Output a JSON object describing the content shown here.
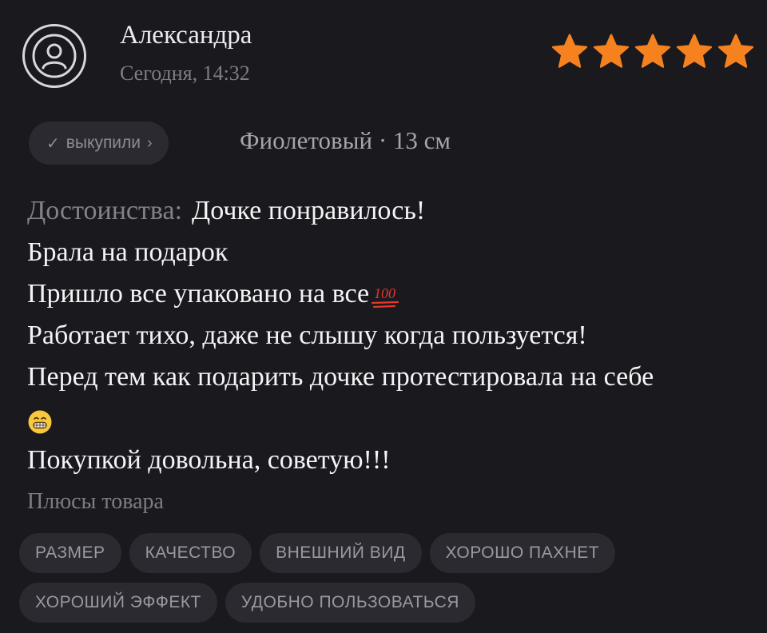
{
  "review": {
    "author": "Александра",
    "date": "Сегодня, 14:32",
    "rating": 5,
    "rating_max": 5,
    "star_color": "#f6821f",
    "bought_label": "выкупили",
    "variant": "Фиолетовый · 13 см",
    "merits_label": "Достоинства:",
    "text_lines": [
      "Дочке понравилось!",
      "Брала на подарок",
      "Пришло все упаковано на все",
      "Работает тихо, даже не слышу когда пользуется!",
      "Перед тем как подарить дочке протестировала на себе",
      "Покупкой довольна, советую!!!"
    ],
    "emoji_100": "100",
    "icons": {
      "avatar": "user-avatar-icon",
      "check": "check-icon",
      "chevron": "chevron-right-icon",
      "star": "star-icon",
      "emoji_100": "hundred-points-emoji",
      "emoji_grin": "grinning-face-emoji"
    }
  },
  "pluses": {
    "title": "Плюсы товара",
    "tags": [
      "РАЗМЕР",
      "КАЧЕСТВО",
      "ВНЕШНИЙ ВИД",
      "ХОРОШО ПАХНЕТ",
      "ХОРОШИЙ ЭФФЕКТ",
      "УДОБНО ПОЛЬЗОВАТЬСЯ"
    ]
  }
}
